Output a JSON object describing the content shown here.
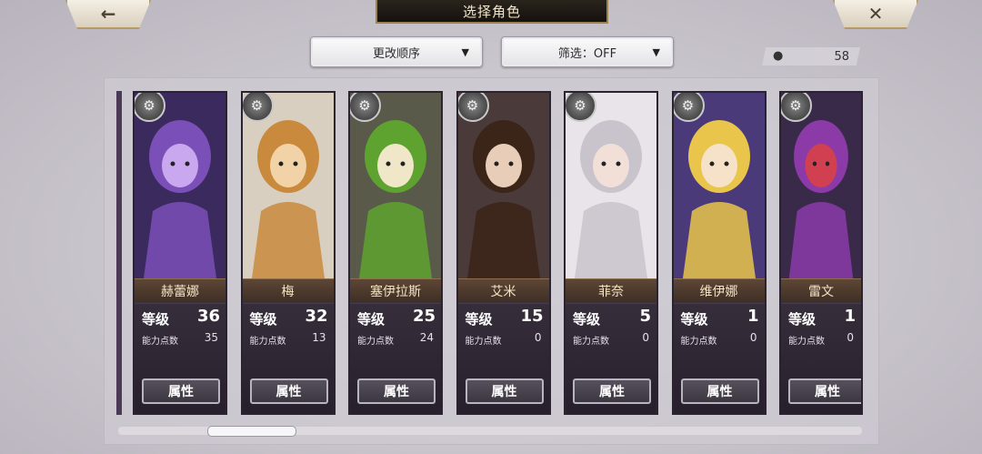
{
  "header": {
    "title": "选择角色",
    "back_icon": "back-arrow-icon",
    "close_icon": "close-icon"
  },
  "toolbar": {
    "sort_label": "更改顺序",
    "filter_label": "筛选：OFF",
    "character_count": "58"
  },
  "labels": {
    "level": "等级",
    "ability_points": "能力点数",
    "attributes": "属性"
  },
  "characters": [
    {
      "name": "赫蕾娜",
      "level": "36",
      "ability_points": "35",
      "weapon": "whip-icon"
    },
    {
      "name": "梅",
      "level": "32",
      "ability_points": "13",
      "weapon": "hammer-icon"
    },
    {
      "name": "塞伊拉斯",
      "level": "25",
      "ability_points": "24",
      "weapon": "sword-icon"
    },
    {
      "name": "艾米",
      "level": "15",
      "ability_points": "0",
      "weapon": "fist-icon"
    },
    {
      "name": "菲奈",
      "level": "5",
      "ability_points": "0",
      "weapon": "whip-icon"
    },
    {
      "name": "维伊娜",
      "level": "1",
      "ability_points": "0",
      "weapon": "whip-icon"
    },
    {
      "name": "雷文",
      "level": "1",
      "ability_points": "0",
      "weapon": "whip-icon"
    }
  ],
  "colors": {
    "accent_gold": "#b59a63",
    "nameplate": "#5d4636",
    "stat_panel": "#3c3241"
  }
}
